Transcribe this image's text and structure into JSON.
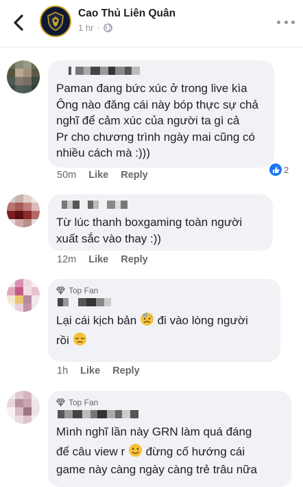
{
  "header": {
    "page_name": "Cao Thủ Liên Quân",
    "time": "1 hr",
    "separator": "·"
  },
  "comments": [
    {
      "lines": [
        "Paman đang bức xúc ở trong live kìa",
        "Ông nào đăng cái này bóp thực sự chả",
        "nghĩ để cảm xúc của người ta gì cả",
        "Pr cho chương trình ngày mai cũng có",
        "nhiều cách mà :)))"
      ],
      "time": "50m",
      "like": "Like",
      "reply": "Reply",
      "reaction_count": "2"
    },
    {
      "lines": [
        "Từ lúc thanh boxgaming toàn người",
        "xuất sắc vào thay :))"
      ],
      "time": "12m",
      "like": "Like",
      "reply": "Reply"
    },
    {
      "badge": "Top Fan",
      "line1_before": "Lại cái kịch bản ",
      "line1_after": " đi vào lòng người",
      "line2": "rồi ",
      "time": "1h",
      "like": "Like",
      "reply": "Reply"
    },
    {
      "badge": "Top Fan",
      "line1": "Mình nghĩ lần này GRN làm quá đáng",
      "line2_before": "để câu view r ",
      "line2_after": " đừng cố hướng cái",
      "line3": "game này càng ngày càng trẻ trâu nữa"
    }
  ],
  "icons": [
    "back-arrow-icon",
    "page-logo-icon",
    "globe-icon",
    "more-icon",
    "like-reaction-icon",
    "sad-sweat-emoji-icon",
    "unamused-emoji-icon",
    "slight-smile-emoji-icon",
    "top-fan-diamond-icon"
  ],
  "colors": {
    "bubble": "#f0f2f5",
    "meta": "#65676b",
    "like_blue": "#1877f2",
    "text": "#1c1e21"
  }
}
